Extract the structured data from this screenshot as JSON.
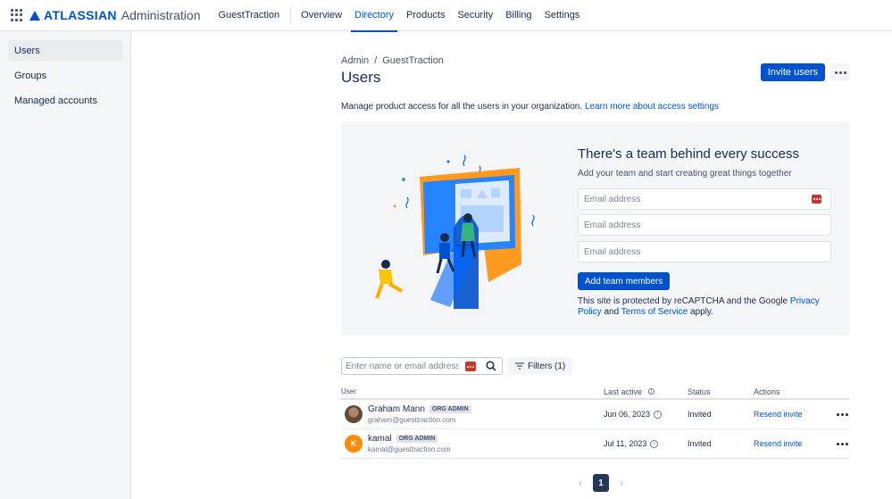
{
  "topnav": {
    "brand": "ATLASSIAN",
    "brand_sub": "Administration",
    "org": "GuestTraction",
    "tabs": [
      "Overview",
      "Directory",
      "Products",
      "Security",
      "Billing",
      "Settings"
    ],
    "active_tab": "Directory"
  },
  "sidebar": {
    "items": [
      "Users",
      "Groups",
      "Managed accounts"
    ],
    "active": "Users"
  },
  "main": {
    "breadcrumb": [
      "Admin",
      "GuestTraction"
    ],
    "breadcrumb_sep": "/",
    "title": "Users",
    "invite_button": "Invite users",
    "description": "Manage product access for all the users in your organization.",
    "description_link": "Learn more about access settings"
  },
  "banner": {
    "title": "There's a team behind every success",
    "subtitle": "Add your team and start creating great things together",
    "email_placeholder": "Email address",
    "add_button": "Add team members",
    "recaptcha_prefix": "This site is protected by reCAPTCHA and the Google",
    "privacy_link": "Privacy Policy",
    "and": "and",
    "terms_link": "Terms of Service",
    "apply": "apply."
  },
  "search": {
    "placeholder": "Enter name or email address",
    "filters_label": "Filters (1)"
  },
  "table": {
    "headers": [
      "User",
      "Last active",
      "Status",
      "Actions"
    ],
    "rows": [
      {
        "name": "Graham Mann",
        "badge": "ORG ADMIN",
        "email": "graham@guesttraction.com",
        "last_active": "Jun 06, 2023",
        "status": "Invited",
        "action": "Resend invite",
        "avatar": "photo",
        "initial": ""
      },
      {
        "name": "kamal",
        "badge": "ORG ADMIN",
        "email": "kamal@guesttraction.com",
        "last_active": "Jul 11, 2023",
        "status": "Invited",
        "action": "Resend invite",
        "avatar": "letter",
        "initial": "K"
      }
    ]
  },
  "pagination": {
    "current": "1",
    "prev": "‹",
    "next": "›"
  },
  "colors": {
    "accent": "#0052cc",
    "avatar_k": "#ff8b00",
    "password_icon": "#c9372c"
  }
}
